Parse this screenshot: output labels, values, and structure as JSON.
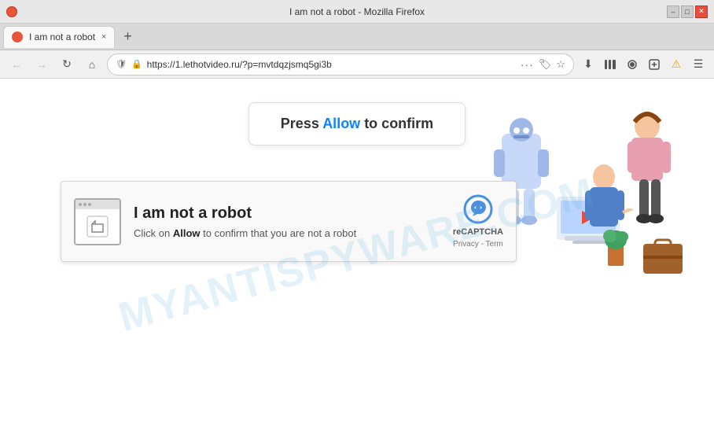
{
  "titleBar": {
    "title": "I am not a robot - Mozilla Firefox",
    "minimize": "–",
    "maximize": "□",
    "close": "✕"
  },
  "tab": {
    "label": "I am not a robot",
    "closeBtn": "×"
  },
  "newTabBtn": "+",
  "navBar": {
    "back": "←",
    "forward": "→",
    "reload": "↻",
    "home": "⌂",
    "addressShield": "🛡",
    "addressLock": "🔒",
    "addressUrl": "https://1.lethotvideo.ru/?p=mvtdqzjsmq5gi3b",
    "addressDots": "···",
    "addressStar": "☆",
    "downloadIcon": "⬇",
    "libraryIcon": "📚",
    "syncIcon": "👤",
    "extensionsIcon": "🔧",
    "overflowIcon": "☰",
    "alertIcon": "⚠"
  },
  "watermark": "MYANTISPYWARE.COM",
  "allowBox": {
    "prefix": "Press ",
    "highlight": "Allow",
    "suffix": " to confirm"
  },
  "recaptcha": {
    "title": "I am not a robot",
    "subtitlePrefix": "Click on ",
    "subtitleAllow": "Allow",
    "subtitleSuffix": " to confirm that you are not a robot",
    "logoLabel": "reCAPTCHA",
    "privacyText": "Privacy - Term"
  }
}
